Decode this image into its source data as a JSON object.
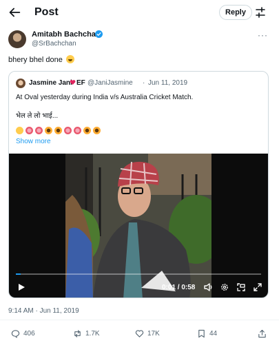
{
  "header": {
    "title": "Post",
    "reply_label": "Reply"
  },
  "tweet": {
    "author_name": "Amitabh Bachchan",
    "author_handle": "@SrBachchan",
    "text": "bhery bhel done",
    "text_emoji": "rolling-on-the-floor-laughing",
    "timestamp": "9:14 AM · Jun 11, 2019"
  },
  "quoted": {
    "author_name": "Jasmine Jani",
    "author_suffix": "EF",
    "author_handle": "@JaniJasmine",
    "separator": "·",
    "date": "Jun 11, 2019",
    "text_line1": "At Oval yesterday during India v/s Australia Cricket Match.",
    "text_line2": "भेल ले लो भाई...",
    "emoji_row": [
      "face-with-tears-of-joy",
      "cherry-blossom",
      "cherry-blossom",
      "sunflower",
      "sunflower",
      "cherry-blossom",
      "cherry-blossom",
      "sunflower",
      "sunflower"
    ],
    "show_more": "Show more"
  },
  "video": {
    "time_display": "0:01 / 0:58",
    "progress_fraction": 0.02
  },
  "actions": {
    "replies": "406",
    "reposts": "1.7K",
    "likes": "17K",
    "bookmarks": "44"
  },
  "colors": {
    "accent": "#1d9bf0",
    "text": "#0f1419",
    "muted": "#536471",
    "border": "#cfd9de"
  }
}
